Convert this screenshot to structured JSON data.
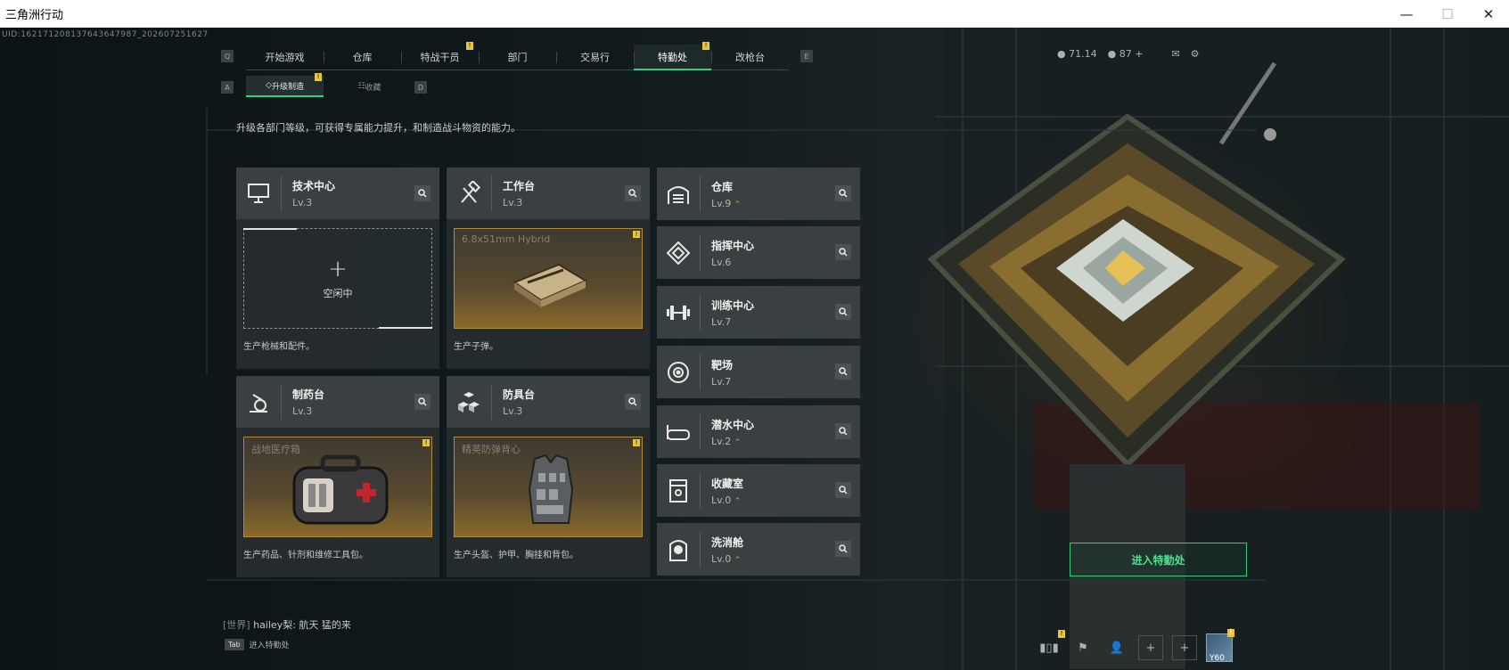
{
  "window": {
    "title": "三角洲行动",
    "min": "—",
    "max": "☐",
    "close": "✕"
  },
  "uid": "UID:1621712081376436479​87_202607251627",
  "nav": {
    "left_key": "Q",
    "right_key": "E",
    "tabs": [
      {
        "label": "开始游戏",
        "badge": ""
      },
      {
        "label": "仓库",
        "badge": ""
      },
      {
        "label": "特战干员",
        "badge": "!"
      },
      {
        "label": "部门",
        "badge": ""
      },
      {
        "label": "交易行",
        "badge": ""
      },
      {
        "label": "特勤处",
        "badge": "!",
        "active": true
      },
      {
        "label": "改枪台",
        "badge": ""
      }
    ]
  },
  "subnav": {
    "left_key": "A",
    "right_key": "D",
    "tabs": [
      {
        "label": "升级制造",
        "badge": "!",
        "active": true
      },
      {
        "label": "收藏"
      }
    ]
  },
  "resources": {
    "currency1": "71.14",
    "currency2": "87 +"
  },
  "description": "升级各部门等级，可获得专属能力提升，和制造战斗物资的能力。",
  "left_cards": [
    {
      "name": "技术中心",
      "level": "Lv.3",
      "slot_state": "空闲中",
      "slot_item": "",
      "footer": "生产枪械和配件。"
    },
    {
      "name": "工作台",
      "level": "Lv.3",
      "slot_item": "6.8x51mm Hybrid",
      "footer": "生产子弹。"
    },
    {
      "name": "制药台",
      "level": "Lv.3",
      "slot_item": "战地医疗箱",
      "footer": "生产药品、针剂和维修工具包。"
    },
    {
      "name": "防具台",
      "level": "Lv.3",
      "slot_item": "精英防弹背心",
      "footer": "生产头盔、护甲、胸挂和背包。"
    }
  ],
  "right_list": [
    {
      "name": "仓库",
      "level": "Lv.9",
      "upgradable": true
    },
    {
      "name": "指挥中心",
      "level": "Lv.6",
      "upgradable": false
    },
    {
      "name": "训练中心",
      "level": "Lv.7",
      "upgradable": false
    },
    {
      "name": "靶场",
      "level": "Lv.7",
      "upgradable": false
    },
    {
      "name": "潜水中心",
      "level": "Lv.2",
      "upgradable": true
    },
    {
      "name": "收藏室",
      "level": "Lv.0",
      "upgradable": true
    },
    {
      "name": "洗消舱",
      "level": "Lv.0",
      "upgradable": true
    }
  ],
  "enter_button": "进入特勤处",
  "chat": {
    "channel": "[世界]",
    "user": "hailey梨",
    "message": "航天 猛的来"
  },
  "tab_hint": {
    "key": "Tab",
    "label": "进入特勤处"
  },
  "avatar_level": "Y60",
  "colors": {
    "accent": "#35d07f",
    "gold": "#d2a338",
    "badge": "#e8c53a"
  }
}
